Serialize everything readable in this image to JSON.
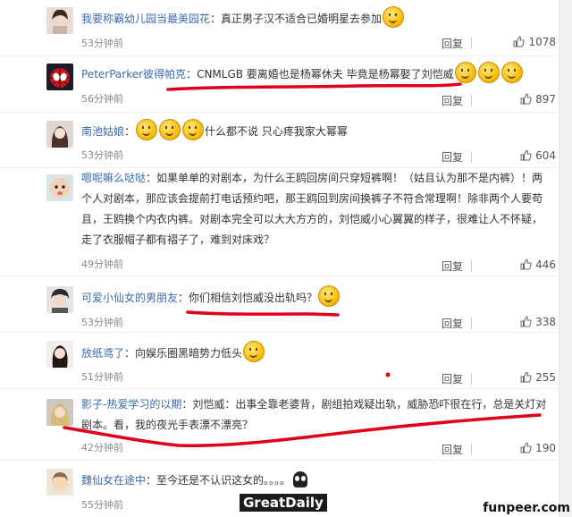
{
  "comments": [
    {
      "user": "我要称霸幼儿园当最美园花",
      "sep": "：",
      "text": "真正男子汉不适合已婚明星去参加",
      "emoji_after": 1,
      "time": "53分钟前",
      "reply": "回复",
      "likes": "1078",
      "avatar": "girl"
    },
    {
      "user": "PeterParker彼得帕克",
      "sep": "：",
      "text": "CNMLGB 要离婚也是杨幂休夫 毕竟是杨幂娶了刘恺威",
      "emoji_after": 3,
      "time": "56分钟前",
      "reply": "回复",
      "likes": "897",
      "avatar": "spider"
    },
    {
      "user": "南池姑娘",
      "sep": "：",
      "emoji_before": 3,
      "text": "什么都不说 只心疼我家大幂幂",
      "time": "53分钟前",
      "reply": "回复",
      "likes": "604",
      "avatar": "woman"
    },
    {
      "user": "嗯呢嘛么哒哒",
      "sep": "：",
      "text": "如果单单的对剧本，为什么王鸥回房间只穿短裤啊！（姑且认为那不是内裤）！两个人对剧本，那应该会提前打电话预约吧，那王鸥回到房间换裤子不符合常理啊！除非两个人要苟且，王鸥换个内衣内裤。对剧本完全可以大大方方的，刘恺威小心翼翼的样子，很难让人不怀疑，走了衣服帽子都有褶子了，难到对床戏？",
      "time": "49分钟前",
      "reply": "回复",
      "likes": "446",
      "avatar": "baby"
    },
    {
      "user": "可爱小仙女的男朋友",
      "sep": "：",
      "text": "你们相信刘恺威没出轨吗？",
      "emoji_after": 1,
      "time": "53分钟前",
      "reply": "回复",
      "likes": "338",
      "avatar": "boy"
    },
    {
      "user": "放纸鸢了",
      "sep": "：",
      "text": "向娱乐圈黑暗势力低头",
      "emoji_after": 1,
      "time": "51分钟前",
      "reply": "回复",
      "likes": "255",
      "avatar": "lady"
    },
    {
      "user": "影子-热爱学习的以期",
      "sep": "：",
      "text": "刘恺威：出事全靠老婆背，剧组拍戏疑出轨，威胁恐吓很在行，总是关灯对剧本。看，我的夜光手表漂不漂亮？",
      "time": "42分钟前",
      "reply": "回复",
      "likes": "190",
      "avatar": "blond"
    },
    {
      "user": "魏仙女在途中",
      "sep": "：",
      "text": "至今还是不认识这女的。。。。",
      "ghost": true,
      "time": "55分钟前",
      "reply": "",
      "likes": "",
      "avatar": "kid"
    }
  ],
  "watermarks": {
    "left": "GreatDaily",
    "right": "funpeer.com"
  },
  "colors": {
    "username": "#3b6aa8",
    "underline": "#e0001a"
  }
}
